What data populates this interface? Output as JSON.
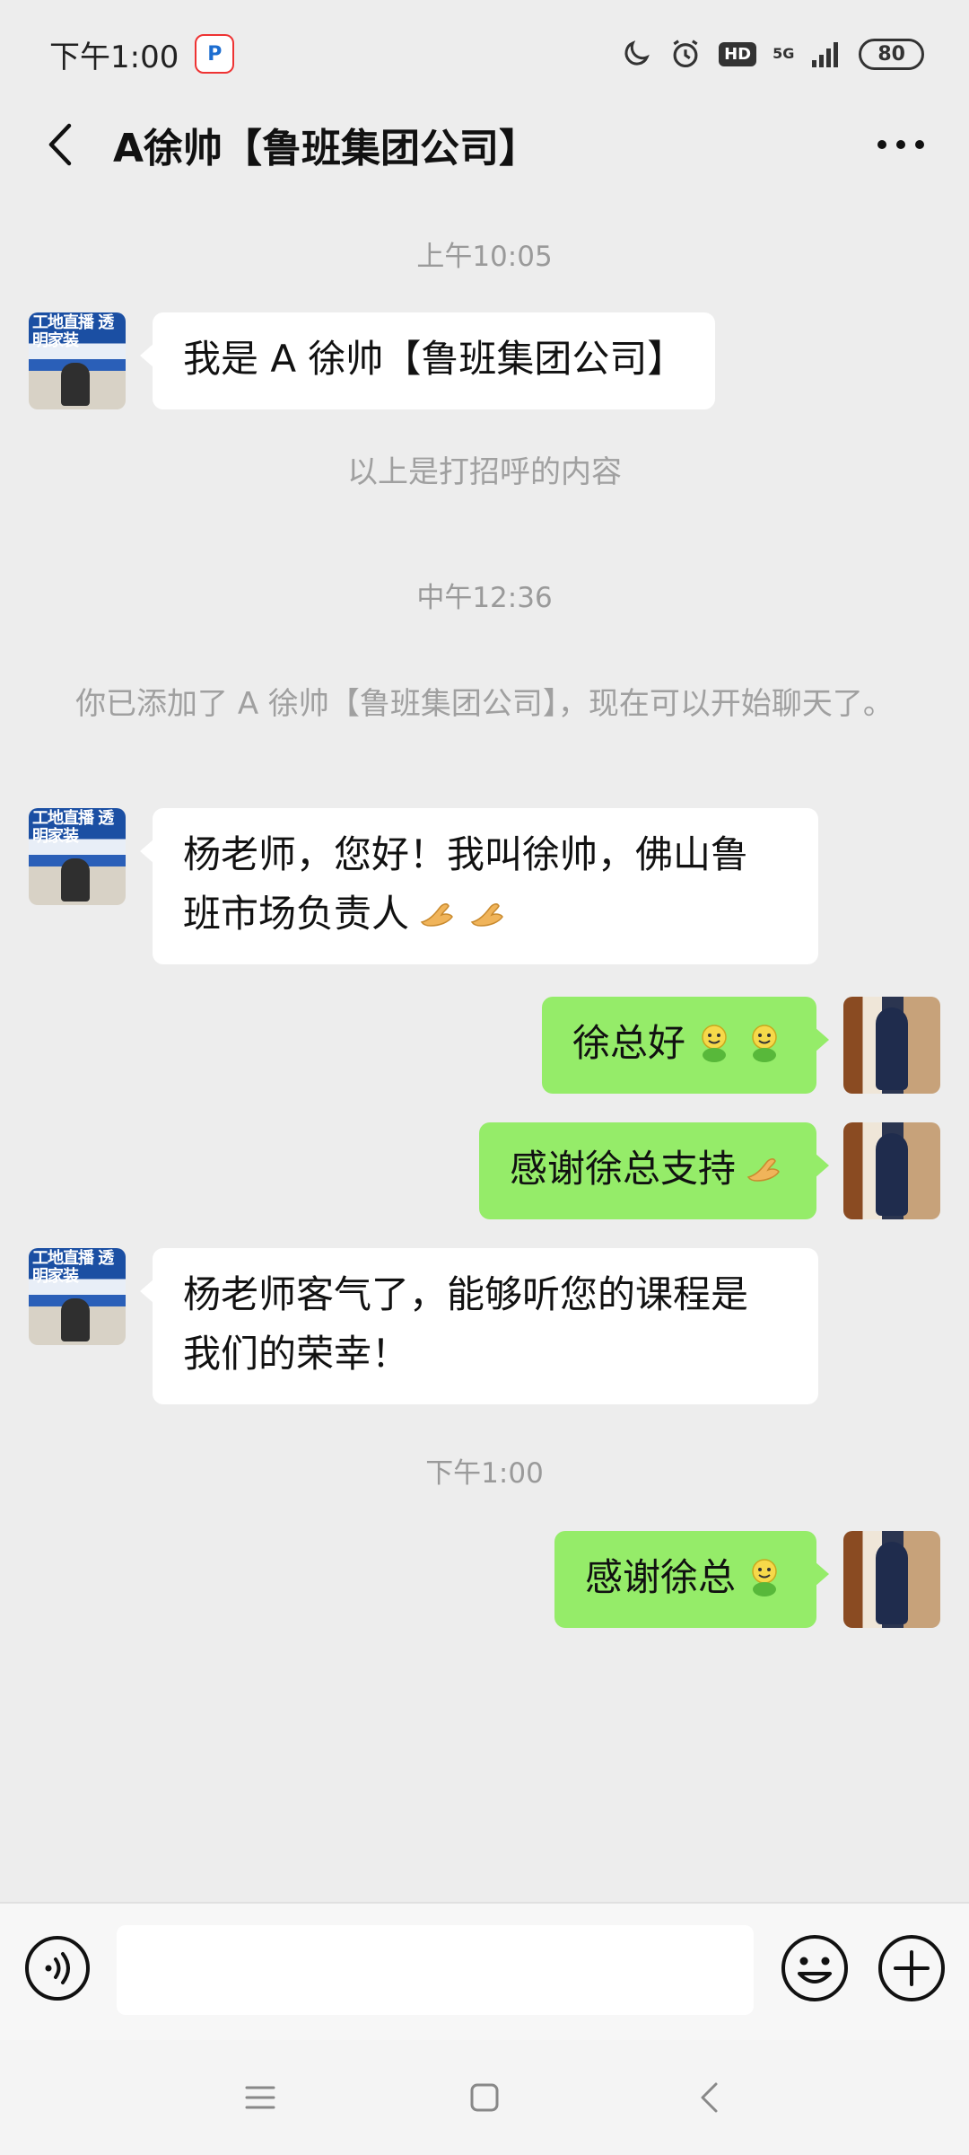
{
  "status_bar": {
    "time": "下午1:00",
    "network": "5G",
    "hd": "HD",
    "battery": "80"
  },
  "header": {
    "title": "A徐帅【鲁班集团公司】"
  },
  "messages": [
    {
      "type": "time",
      "text": "上午10:05"
    },
    {
      "type": "incoming",
      "text": "我是 A 徐帅【鲁班集团公司】",
      "avatar_text": "工地直播 透明家装"
    },
    {
      "type": "system",
      "text": "以上是打招呼的内容"
    },
    {
      "type": "time",
      "text": "中午12:36"
    },
    {
      "type": "system",
      "text": "你已添加了 A 徐帅【鲁班集团公司】，现在可以开始聊天了。"
    },
    {
      "type": "incoming",
      "line1": "杨老师，您好！我叫徐帅，佛山鲁",
      "line2": "班市场负责人",
      "emojis": [
        "ok-hand-icon",
        "ok-hand-icon"
      ],
      "avatar_text": "工地直播 透明家装"
    },
    {
      "type": "outgoing",
      "text": "徐总好",
      "emojis": [
        "smiley-emoji-icon",
        "smiley-emoji-icon"
      ]
    },
    {
      "type": "outgoing",
      "text": "感谢徐总支持",
      "emojis": [
        "ok-hand-icon"
      ]
    },
    {
      "type": "incoming",
      "line1": "杨老师客气了，能够听您的课程是",
      "line2": "我们的荣幸！",
      "avatar_text": "工地直播 透明家装"
    },
    {
      "type": "time",
      "text": "下午1:00"
    },
    {
      "type": "outgoing",
      "text": "感谢徐总",
      "emojis": [
        "smiley-emoji-icon"
      ]
    }
  ],
  "input": {
    "value": "",
    "placeholder": ""
  },
  "colors": {
    "background": "#EDEDED",
    "outgoing_bubble": "#95EC69",
    "incoming_bubble": "#FFFFFF"
  }
}
